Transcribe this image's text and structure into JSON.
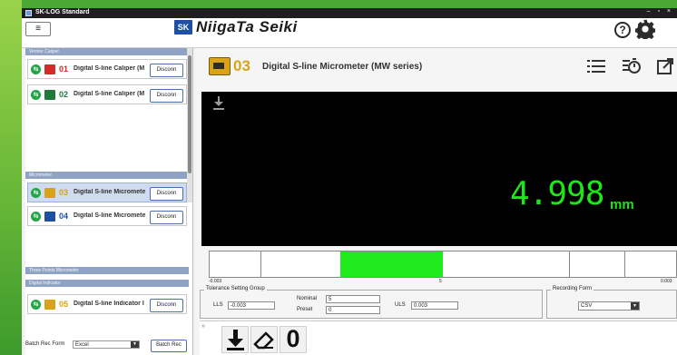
{
  "window": {
    "title": "SK-LOG Standard",
    "controls": "– ▫ ×"
  },
  "header": {
    "menu_glyph": "≡",
    "logo_mark": "SK",
    "logo_text": "NiigaTa Seiki",
    "help_glyph": "?"
  },
  "sidebar": {
    "groups": [
      {
        "label": "Vernier Caliper"
      },
      {
        "label": "Micrometer"
      },
      {
        "label": "Three Points Micrometer"
      },
      {
        "label": "Digital Indicator"
      }
    ],
    "devices": [
      {
        "num": "01",
        "name": "Digital S-line Caliper (M",
        "button": "Disconn",
        "num_color": "#d42a2a"
      },
      {
        "num": "02",
        "name": "Digital S-line Caliper (M",
        "button": "Disconn",
        "num_color": "#1f7a3a"
      },
      {
        "num": "03",
        "name": "Digital S-line Micromete",
        "button": "Disconn",
        "num_color": "#d8a316"
      },
      {
        "num": "04",
        "name": "Digital S-line Micromete",
        "button": "Disconn",
        "num_color": "#1d4fa3"
      },
      {
        "num": "05",
        "name": "Digital S-line Indicator I",
        "button": "Disconn",
        "num_color": "#d8a316"
      }
    ],
    "batch": {
      "label": "Batch Rec Form",
      "value": "Excel",
      "button": "Batch Rec"
    }
  },
  "device_header": {
    "num": "03",
    "name": "Digital S-line Micrometer (MW series)"
  },
  "display": {
    "reading": "4.998",
    "unit": "mm"
  },
  "gauge": {
    "min_label": "-0.003",
    "mid_label": "5",
    "max_label": "0.003",
    "fill_from": 0.28,
    "fill_to": 0.5
  },
  "tolerance": {
    "title": "Tolerance Setting Group",
    "lls_label": "LLS",
    "lls_value": "-0.003",
    "nominal_label": "Nominal",
    "nominal_value": "5",
    "preset_label": "Preset",
    "preset_value": "0",
    "uls_label": "ULS",
    "uls_value": "0.003"
  },
  "recording": {
    "title": "Recording Form",
    "value": "CSV"
  },
  "bottombar": {
    "chevron": "»",
    "zero_label": "0"
  },
  "colors": {
    "display_green": "#1fe51a",
    "accent_blue": "#1d4fa3",
    "connect_green": "#22a447"
  }
}
